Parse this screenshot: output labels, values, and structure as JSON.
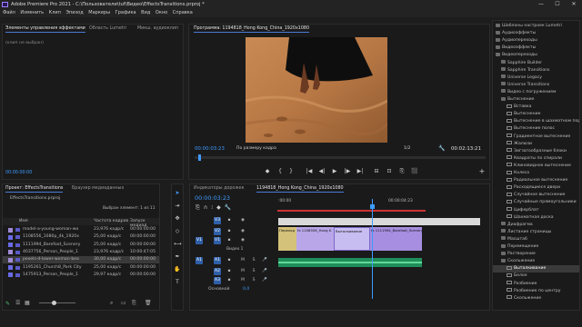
{
  "titlebar": {
    "text": "Adobe Premiere Pro 2021 - C:\\Пользователи\\tuf\\Видео\\EffectsTransitions.prproj *",
    "minimize": "—",
    "maximize": "☐",
    "close": "✕"
  },
  "menu": [
    "Файл",
    "Изменить",
    "Клип",
    "Эпизод",
    "Маркеры",
    "Графика",
    "Вид",
    "Окно",
    "Справка"
  ],
  "effect_controls": {
    "tabs": [
      "Элементы управления эффектами",
      "Область Lumetri",
      "Микш. аудиоклип"
    ],
    "placeholder": "(клип не выбран)",
    "timecode": "00:00:00:00"
  },
  "program": {
    "title": "Программа: 1194818_Hong Kong_China_1920x1080",
    "timecode_left": "00:00:03:23",
    "fit": "По размеру кадра",
    "resolution": "1/2",
    "timecode_right": "00:02:13:21",
    "controls": [
      "◆",
      "{",
      "}",
      "|◀",
      "◀|",
      "▶",
      "|▶",
      "▶|",
      "⊟",
      "⊡",
      "⎘",
      "⬛"
    ]
  },
  "project": {
    "tabs": [
      "Проект: EffectsTransitions",
      "Браузер медиаданных"
    ],
    "name": "EffectsTransitions.prproj",
    "count": "Выбран элемент: 1 из 11",
    "headers": [
      "Имя",
      "Частота кадров",
      "Запуск медиад"
    ],
    "rows": [
      {
        "name": "model-a-young-woman-wo",
        "fps": "23,976 кадр/с",
        "start": "00:00:00:00",
        "color": "#a08bd6"
      },
      {
        "name": "1108556_1080p_4k_1920x",
        "fps": "25,00 кадр/с",
        "start": "00:00:00:00",
        "color": "#6a6ae6"
      },
      {
        "name": "1111994_Barefoot_Scenery",
        "fps": "25,00 кадр/с",
        "start": "00:00:00:00",
        "color": "#6a6ae6"
      },
      {
        "name": "4037756_Person_People_1",
        "fps": "23,976 кадр/с",
        "start": "10:00:47:05",
        "color": "#a08bd6"
      },
      {
        "name": "pexels-d-lower-woman-bea",
        "fps": "30,00 кадр/с",
        "start": "00:00:00:00",
        "color": "#a08bd6"
      },
      {
        "name": "1195261_Church8_Park City",
        "fps": "25,00 кадр/с",
        "start": "00:00:00:00",
        "color": "#6a6ae6"
      },
      {
        "name": "1475913_Person_People_1",
        "fps": "29,97 кадр/с",
        "start": "00:00:00:00",
        "color": "#6a6ae6"
      }
    ]
  },
  "timeline": {
    "tabs": [
      "Индикаторы дорожек",
      "1194818_Hong Kong_China_1920x1080"
    ],
    "timecode": "00:00:03:23",
    "ruler": [
      ":00:00",
      "00:00:04:23"
    ],
    "tracks": [
      {
        "toggle": "V3",
        "lock": "🔒",
        "eye": "👁",
        "name": ""
      },
      {
        "toggle": "V2",
        "lock": "🔒",
        "eye": "👁",
        "name": ""
      },
      {
        "toggle": "V1",
        "lock": "🔒",
        "eye": "👁",
        "name": "Видео 1"
      },
      {
        "toggle": "A1",
        "lock": "🔒",
        "mute": "M",
        "solo": "S",
        "name": ""
      },
      {
        "toggle": "A2",
        "lock": "🔒",
        "mute": "M",
        "solo": "S",
        "name": ""
      },
      {
        "toggle": "A3",
        "lock": "🔒",
        "mute": "M",
        "solo": "S",
        "name": ""
      }
    ],
    "v1_label": "V1",
    "a1_label": "A1",
    "master": "Основной",
    "master_val": "0,0",
    "clips": [
      "Переход",
      "fx  1108556_Hong K",
      "Выталкивание",
      "fx  1111994_Barefoot_Scenery"
    ]
  },
  "effects": {
    "items": [
      {
        "name": "Шаблоны настроек Lumetri",
        "type": "fold",
        "indent": 0
      },
      {
        "name": "Аудиоэффекты",
        "type": "fold",
        "indent": 0
      },
      {
        "name": "Аудиопереходы",
        "type": "fold",
        "indent": 0
      },
      {
        "name": "Видеоэффекты",
        "type": "fold",
        "indent": 0
      },
      {
        "name": "Видеопереходы",
        "type": "fold",
        "indent": 0
      },
      {
        "name": "Sapphire Builder",
        "type": "fold",
        "indent": 1
      },
      {
        "name": "Sapphire Transitions",
        "type": "fold",
        "indent": 1
      },
      {
        "name": "Universe Legacy",
        "type": "fold",
        "indent": 1
      },
      {
        "name": "Universe Transitions",
        "type": "fold",
        "indent": 1
      },
      {
        "name": "Видео с погружением",
        "type": "fold",
        "indent": 1
      },
      {
        "name": "Вытеснение",
        "type": "fold",
        "indent": 1
      },
      {
        "name": "Вставка",
        "type": "tr",
        "indent": 2
      },
      {
        "name": "Вытеснение",
        "type": "tr",
        "indent": 2
      },
      {
        "name": "Вытеснение в шахматном пор",
        "type": "tr",
        "indent": 2
      },
      {
        "name": "Вытеснение полос",
        "type": "tr",
        "indent": 2
      },
      {
        "name": "Градиентное вытеснение",
        "type": "tr",
        "indent": 2
      },
      {
        "name": "Жалюзи",
        "type": "tr",
        "indent": 2
      },
      {
        "name": "Зигзагообразные блоки",
        "type": "tr",
        "indent": 2
      },
      {
        "name": "Квадраты по спирали",
        "type": "tr",
        "indent": 2
      },
      {
        "name": "Клиновидное вытеснение",
        "type": "tr",
        "indent": 2
      },
      {
        "name": "Колесо",
        "type": "tr",
        "indent": 2
      },
      {
        "name": "Радиальное вытеснение",
        "type": "tr",
        "indent": 2
      },
      {
        "name": "Расходящиеся двери",
        "type": "tr",
        "indent": 2
      },
      {
        "name": "Случайное вытеснение",
        "type": "tr",
        "indent": 2
      },
      {
        "name": "Случайные прямоугольники",
        "type": "tr",
        "indent": 2
      },
      {
        "name": "Циферблат",
        "type": "tr",
        "indent": 2
      },
      {
        "name": "Шахматная доска",
        "type": "tr",
        "indent": 2
      },
      {
        "name": "Диафрагма",
        "type": "fold",
        "indent": 1
      },
      {
        "name": "Листание страницы",
        "type": "fold",
        "indent": 1
      },
      {
        "name": "Масштаб",
        "type": "fold",
        "indent": 1
      },
      {
        "name": "Перемещение",
        "type": "fold",
        "indent": 1
      },
      {
        "name": "Растворение",
        "type": "fold",
        "indent": 1
      },
      {
        "name": "Скольжение",
        "type": "fold",
        "indent": 1
      },
      {
        "name": "Выталкивание",
        "type": "tr",
        "indent": 2,
        "selected": true
      },
      {
        "name": "Белое",
        "type": "tr",
        "indent": 2
      },
      {
        "name": "Разбиение",
        "type": "tr",
        "indent": 2
      },
      {
        "name": "Разбиение по центру",
        "type": "tr",
        "indent": 2
      },
      {
        "name": "Скольжение",
        "type": "tr",
        "indent": 2
      }
    ]
  }
}
